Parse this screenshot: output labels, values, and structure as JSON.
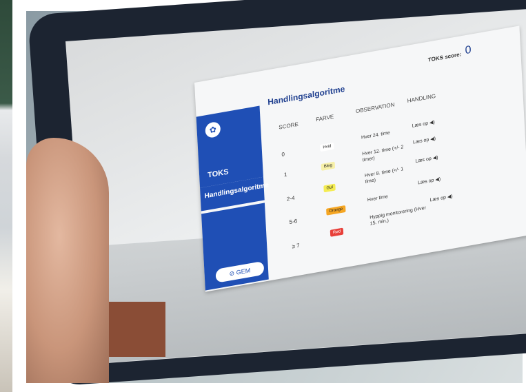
{
  "app": {
    "sidebar": {
      "title": "TOKS",
      "active_item": "Handlingsalgoritme",
      "save_button": "GEM"
    },
    "header": {
      "title": "Handlingsalgoritme",
      "score_label": "TOKS score:",
      "score_value": "0"
    },
    "table": {
      "columns": [
        "SCORE",
        "FARVE",
        "OBSERVATION",
        "HANDLING"
      ],
      "rows": [
        {
          "score": "0",
          "color_label": "Hvid",
          "color": "#ffffff",
          "observation": "Hver 24. time",
          "action": "Læs op"
        },
        {
          "score": "1",
          "color_label": "Bleg",
          "color": "#f7f0a8",
          "observation": "Hver 12. time (+/- 2 timer)",
          "action": "Læs op"
        },
        {
          "score": "2-4",
          "color_label": "Gul",
          "color": "#f4ec52",
          "observation": "Hver 8. time (+/- 1 time)",
          "action": "Læs op"
        },
        {
          "score": "5-6",
          "color_label": "Orange",
          "color": "#f5a623",
          "observation": "Hver time",
          "action": "Læs op"
        },
        {
          "score": "≥ 7",
          "color_label": "Rød",
          "color": "#e8403a",
          "observation": "Hyppig monitorering (Hver 15. min.)",
          "action": "Læs op"
        }
      ]
    }
  },
  "colors": {
    "brand": "#1f4fb5"
  }
}
